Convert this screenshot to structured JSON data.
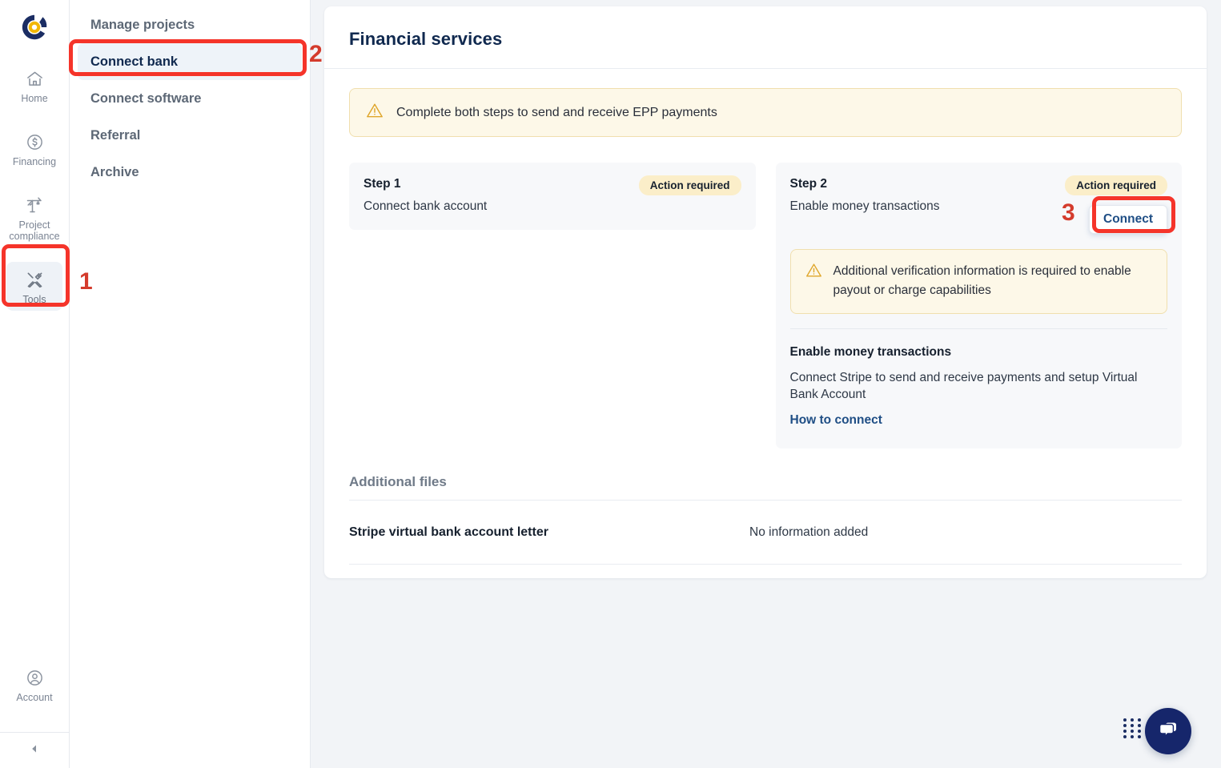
{
  "brand": {
    "logo_name": "company-logo",
    "navy": "#1b2d63",
    "gold": "#f2b705",
    "accent_link": "#1f4e85",
    "annotation_red": "#f5342a"
  },
  "rail": {
    "items": [
      {
        "label": "Home",
        "icon": "home-icon",
        "active": false
      },
      {
        "label": "Financing",
        "icon": "dollar-circle-icon",
        "active": false
      },
      {
        "label": "Project compliance",
        "icon": "crane-icon",
        "active": false
      },
      {
        "label": "Tools",
        "icon": "tools-icon",
        "active": true
      }
    ],
    "account": {
      "label": "Account",
      "icon": "account-circle-icon"
    },
    "collapse": {
      "icon": "collapse-left-icon"
    }
  },
  "subnav": {
    "items": [
      {
        "label": "Manage projects",
        "active": false
      },
      {
        "label": "Connect bank",
        "active": true
      },
      {
        "label": "Connect software",
        "active": false
      },
      {
        "label": "Referral",
        "active": false
      },
      {
        "label": "Archive",
        "active": false
      }
    ]
  },
  "page": {
    "title": "Financial services"
  },
  "banner": {
    "icon": "warning-triangle-icon",
    "text": "Complete both steps to send and receive EPP payments"
  },
  "steps": [
    {
      "title": "Step 1",
      "subtitle": "Connect bank account",
      "badge": "Action required"
    },
    {
      "title": "Step 2",
      "subtitle": "Enable money transactions",
      "badge": "Action required",
      "button": "Connect",
      "warning": {
        "icon": "warning-triangle-icon",
        "text": "Additional verification information is required to enable payout or charge capabilities"
      },
      "detail": {
        "title": "Enable money transactions",
        "description": "Connect Stripe to send and receive payments and setup Virtual Bank Account",
        "link": "How to connect"
      }
    }
  ],
  "files": {
    "heading": "Additional files",
    "rows": [
      {
        "name": "Stripe virtual bank account letter",
        "value": "No information added"
      }
    ]
  },
  "annotations": [
    {
      "number": "1"
    },
    {
      "number": "2"
    },
    {
      "number": "3"
    }
  ],
  "chat": {
    "drag_handle": "chat-drag-handle",
    "button_icon": "chat-bubble-icon"
  }
}
